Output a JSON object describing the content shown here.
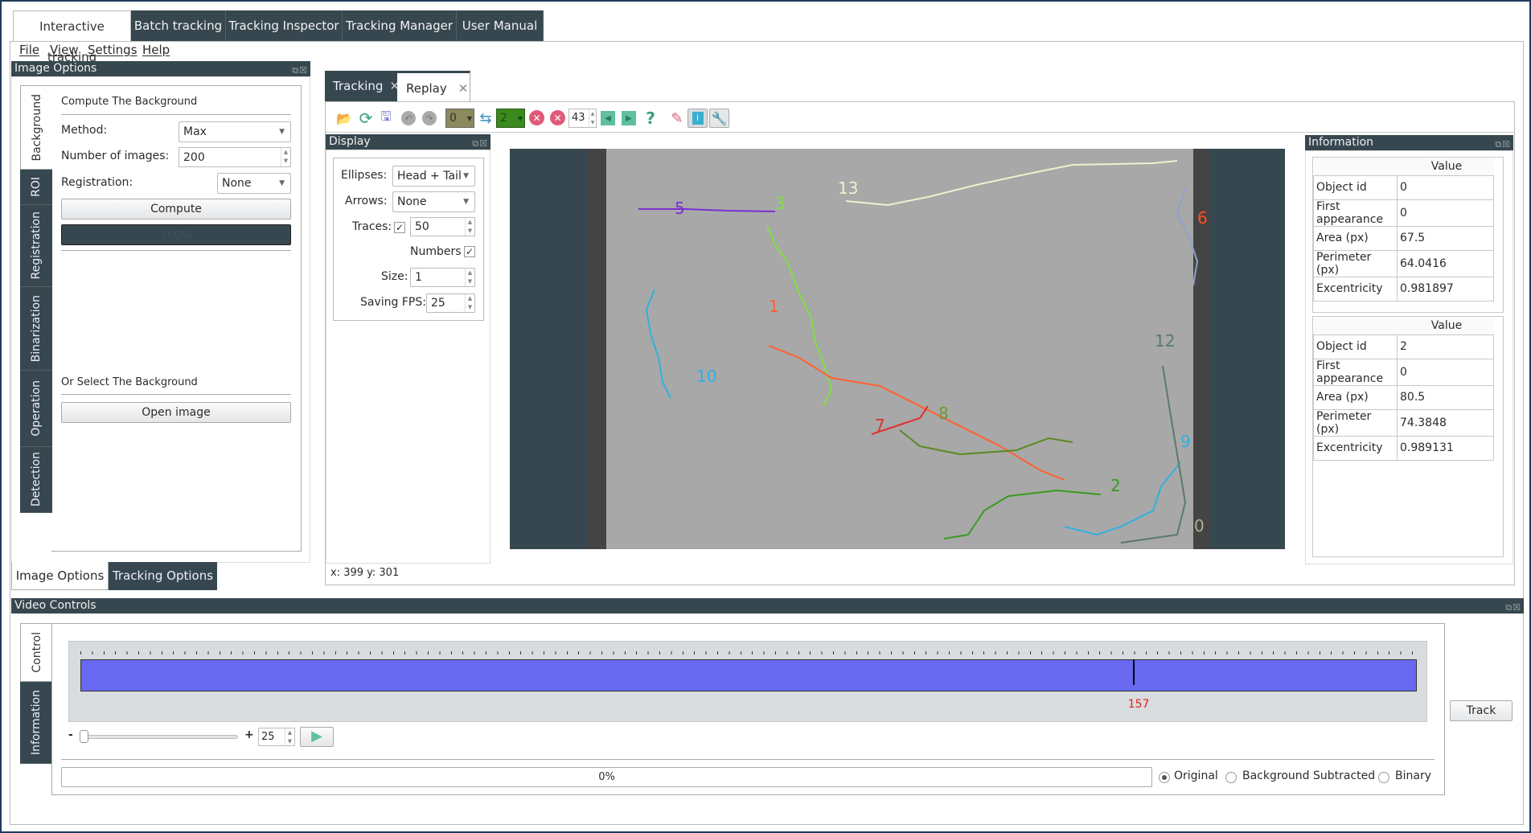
{
  "top_tabs": [
    "Interactive tracking",
    "Batch tracking",
    "Tracking Inspector",
    "Tracking Manager",
    "User Manual"
  ],
  "menu": [
    "File",
    "View",
    "Settings",
    "Help"
  ],
  "image_options": {
    "title": "Image Options",
    "vtabs": [
      "Background",
      "ROI",
      "Registration",
      "Binarization",
      "Operation",
      "Detection"
    ],
    "section1": "Compute The Background",
    "method_label": "Method:",
    "method_value": "Max",
    "nimages_label": "Number of images:",
    "nimages_value": "200",
    "registration_label": "Registration:",
    "registration_value": "None",
    "compute_label": "Compute",
    "compute_progress": "100%",
    "section2": "Or Select The Background",
    "open_image_label": "Open image",
    "bottom_tabs": [
      "Image Options",
      "Tracking Options"
    ]
  },
  "center_tabs": [
    "Tracking",
    "Replay"
  ],
  "toolbar": {
    "combo_a": "0",
    "combo_b": "2",
    "frame_spin": "43",
    "icons": [
      "folder-open-icon",
      "refresh-icon",
      "save-icon",
      "undo-icon",
      "redo-icon",
      "swap-icon",
      "delete-icon",
      "delete-all-icon",
      "previous-icon",
      "next-icon",
      "help-icon",
      "pencil-icon",
      "info-icon",
      "wrench-icon"
    ]
  },
  "display": {
    "title": "Display",
    "ellipses_label": "Ellipses:",
    "ellipses_value": "Head + Tail",
    "arrows_label": "Arrows:",
    "arrows_value": "None",
    "traces_label": "Traces:",
    "traces_checked": true,
    "traces_value": "50",
    "numbers_label": "Numbers",
    "numbers_checked": true,
    "size_label": "Size:",
    "size_value": "1",
    "fps_label": "Saving FPS:",
    "fps_value": "25"
  },
  "video": {
    "track_labels": [
      "0",
      "1",
      "2",
      "3",
      "5",
      "6",
      "7",
      "8",
      "9",
      "10",
      "12",
      "13"
    ]
  },
  "status_coords": "x: 399 y: 301",
  "information": {
    "title": "Information",
    "header": "Value",
    "tables": [
      [
        [
          "Object id",
          "0"
        ],
        [
          "First appearance",
          "0"
        ],
        [
          "Area (px)",
          "67.5"
        ],
        [
          "Perimeter (px)",
          "64.0416"
        ],
        [
          "Excentricity",
          "0.981897"
        ]
      ],
      [
        [
          "Object id",
          "2"
        ],
        [
          "First appearance",
          "0"
        ],
        [
          "Area (px)",
          "80.5"
        ],
        [
          "Perimeter (px)",
          "74.3848"
        ],
        [
          "Excentricity",
          "0.989131"
        ]
      ]
    ]
  },
  "video_controls": {
    "title": "Video Controls",
    "vtabs": [
      "Control",
      "Information"
    ],
    "current_frame": "157",
    "current_frame_fraction": 0.788,
    "minus": "-",
    "plus": "+",
    "speed": "25",
    "progress": "0%",
    "radios": [
      "Original",
      "Background Subtracted",
      "Binary"
    ],
    "selected_radio": "Original",
    "track_label": "Track",
    "colors": {
      "timeline": "#6868f0",
      "frame_label": "#e82020"
    }
  }
}
